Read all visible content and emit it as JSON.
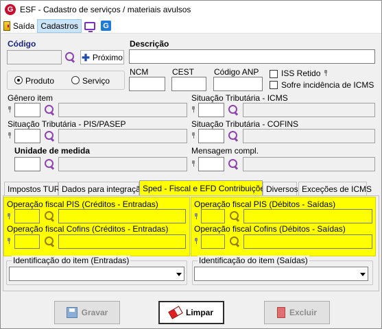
{
  "window": {
    "title": "ESF - Cadastro de serviços / materiais avulsos",
    "logo_letter": "G"
  },
  "menu": {
    "exit": "Saída",
    "cadastros": "Cadastros",
    "g_letter": "G"
  },
  "codigo": {
    "label": "Código",
    "next_label": "Próximo"
  },
  "descricao": {
    "label": "Descrição"
  },
  "tipo": {
    "produto": "Produto",
    "servico": "Serviço",
    "selected": "Produto"
  },
  "ncm": {
    "label": "NCM"
  },
  "cest": {
    "label": "CEST"
  },
  "codigo_anp": {
    "label": "Código ANP"
  },
  "iss_retido": {
    "label": "ISS Retido",
    "checked": false
  },
  "sofre_icms": {
    "label": "Sofre incidência de ICMS",
    "checked": false
  },
  "genero_item": {
    "label": "Gênero item"
  },
  "st_icms": {
    "label": "Situação Tributária - ICMS"
  },
  "st_pis": {
    "label": "Situação Tributária - PIS/PASEP"
  },
  "st_cofins": {
    "label": "Situação Tributária - COFINS"
  },
  "unidade": {
    "label": "Unidade de medida"
  },
  "mensagem": {
    "label": "Mensagem compl."
  },
  "tabs": [
    {
      "label": "Impostos TUR"
    },
    {
      "label": "Dados para integração"
    },
    {
      "label": "Sped - Fiscal e EFD Contribuições",
      "active": true
    },
    {
      "label": "Diversos"
    },
    {
      "label": "Exceções de ICMS"
    }
  ],
  "sped": {
    "op_pis_entradas": "Operação fiscal PIS (Créditos - Entradas)",
    "op_pis_saidas": "Operação fiscal PIS (Débitos - Saídas)",
    "op_cofins_entradas": "Operação fiscal Cofins (Créditos - Entradas)",
    "op_cofins_saidas": "Operação fiscal Cofins (Débitos - Saídas)",
    "ident_entradas": "Identificação do item (Entradas)",
    "ident_saidas": "Identificação do item (Saídas)",
    "highlight_color": "#ffff00"
  },
  "footer": {
    "gravar": "Gravar",
    "limpar": "Limpar",
    "excluir": "Excluir"
  }
}
